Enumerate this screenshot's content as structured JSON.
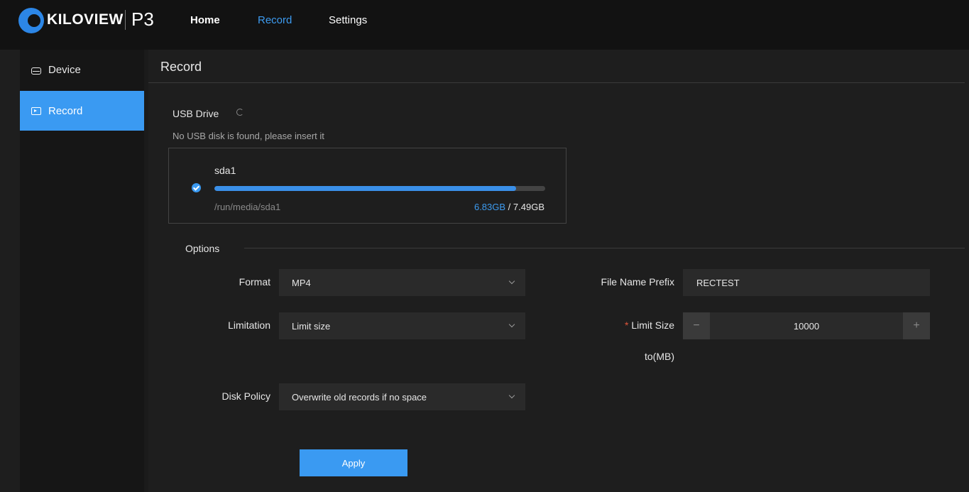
{
  "header": {
    "brand": "KILOVIEW",
    "product": "P3",
    "nav": [
      {
        "label": "Home"
      },
      {
        "label": "Record"
      },
      {
        "label": "Settings"
      }
    ]
  },
  "sidebar": {
    "items": [
      {
        "label": "Device",
        "icon": "drive-icon"
      },
      {
        "label": "Record",
        "icon": "record-icon",
        "active": true
      }
    ]
  },
  "main": {
    "title": "Record",
    "usb_label": "USB Drive",
    "usb_message": "No USB disk is found, please insert it",
    "disk": {
      "name": "sda1",
      "path": "/run/media/sda1",
      "used": "6.83GB",
      "separator": " / ",
      "total": "7.49GB",
      "used_fraction": 0.912
    },
    "options_label": "Options",
    "format": {
      "label": "Format",
      "value": "MP4"
    },
    "limitation": {
      "label": "Limitation",
      "value": "Limit size"
    },
    "disk_policy": {
      "label": "Disk Policy",
      "value": "Overwrite old records if no space"
    },
    "file_name_prefix": {
      "label": "File Name Prefix",
      "value": "RECTEST"
    },
    "limit_size": {
      "required_mark": "*",
      "label_line1": "Limit Size",
      "label_line2": "to(MB)",
      "value": "10000",
      "minus": "−",
      "plus": "+"
    },
    "apply_label": "Apply"
  },
  "colors": {
    "accent": "#3a9af2",
    "background": "#1e1e1e",
    "topbar": "#121212"
  }
}
